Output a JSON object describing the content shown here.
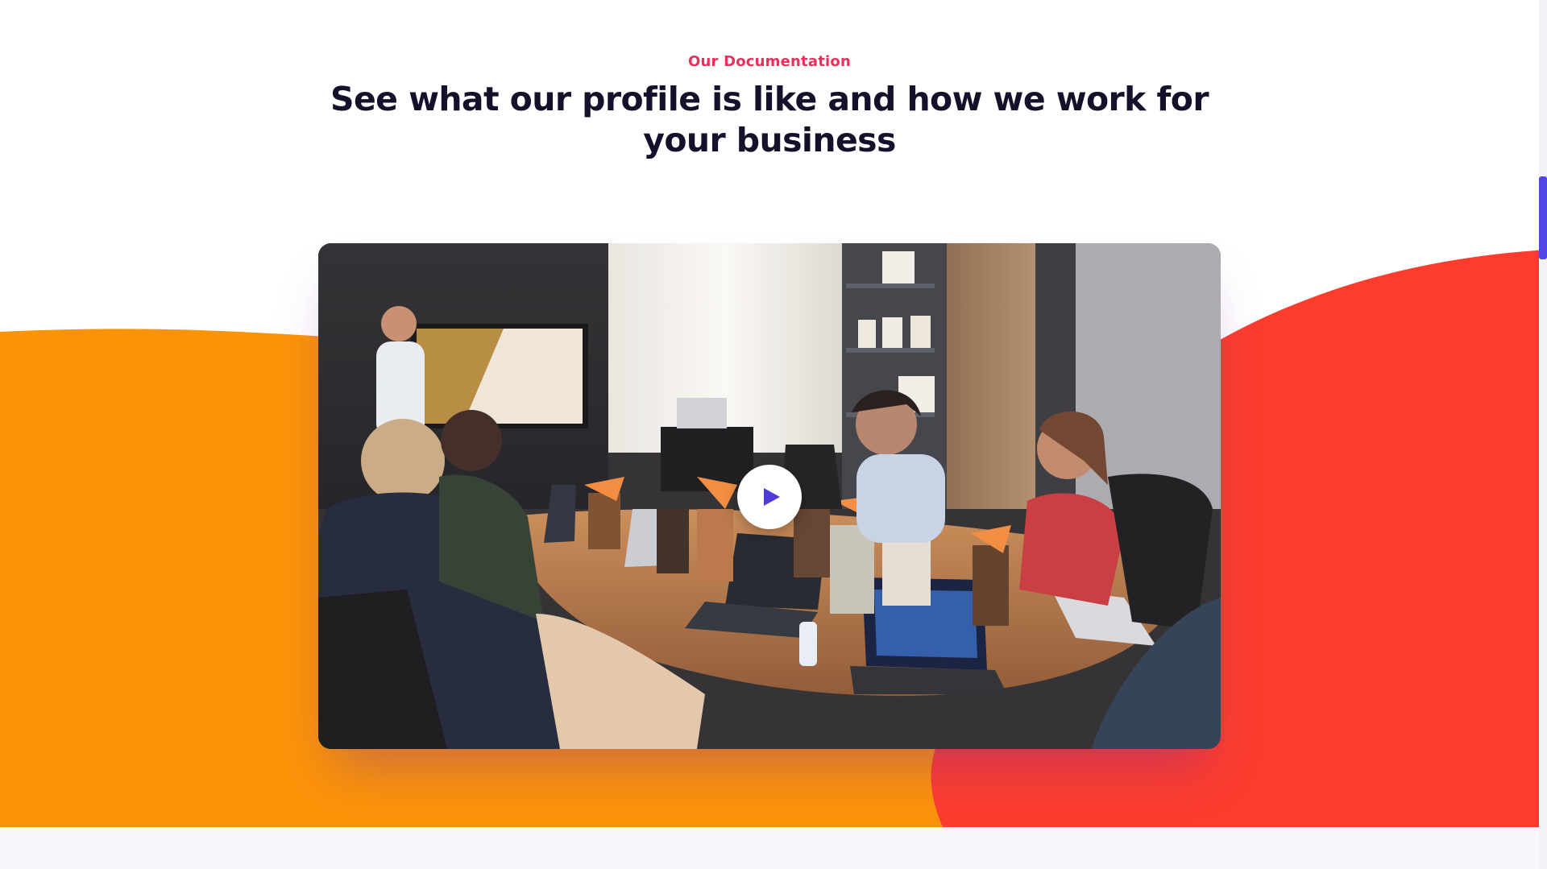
{
  "section": {
    "eyebrow": "Our Documentation",
    "headline": "See what our profile is like and how we work for your business"
  },
  "video": {
    "play_icon": "play-icon",
    "thumbnail": "team-meeting-photo"
  },
  "colors": {
    "eyebrow": "#e8305a",
    "headline": "#14112b",
    "orange_blob": "#fb9309",
    "red_blob": "#fc3d2e",
    "play_icon": "#4f3bd8",
    "scrollbar_thumb": "#4f46e5",
    "footer_strip": "#f7f7fc"
  }
}
